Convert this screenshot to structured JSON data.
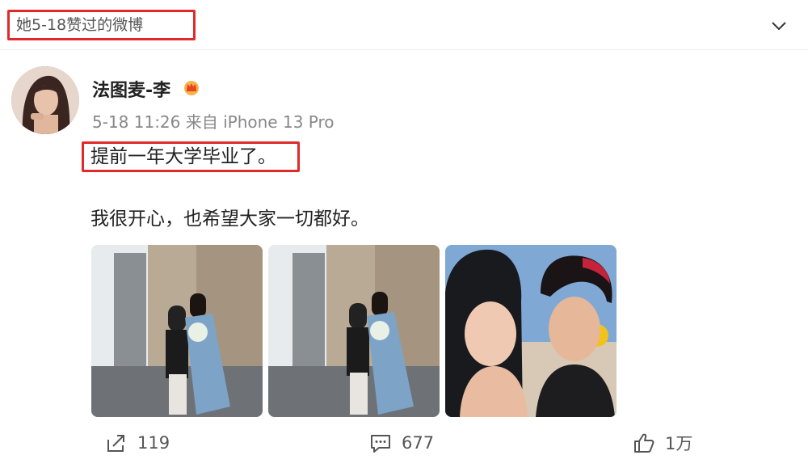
{
  "header": {
    "label": "她5-18赞过的微博",
    "collapse_icon": "chevron-down-icon"
  },
  "post": {
    "username": "法图麦-李",
    "badge_icon": "crown-icon",
    "meta": "5-18 11:26 来自 iPhone 13 Pro",
    "text_line1": "提前一年大学毕业了。",
    "text_line2": "我很开心，也希望大家一切都好。"
  },
  "actions": {
    "repost": {
      "icon": "repost-icon",
      "count": "119"
    },
    "comment": {
      "icon": "comment-icon",
      "count": "677"
    },
    "like": {
      "icon": "thumbs-up-icon",
      "count": "1万"
    }
  },
  "colors": {
    "highlight": "#e02a2a",
    "text": "#222222",
    "meta": "#888888",
    "badge": "#f2a93b"
  }
}
